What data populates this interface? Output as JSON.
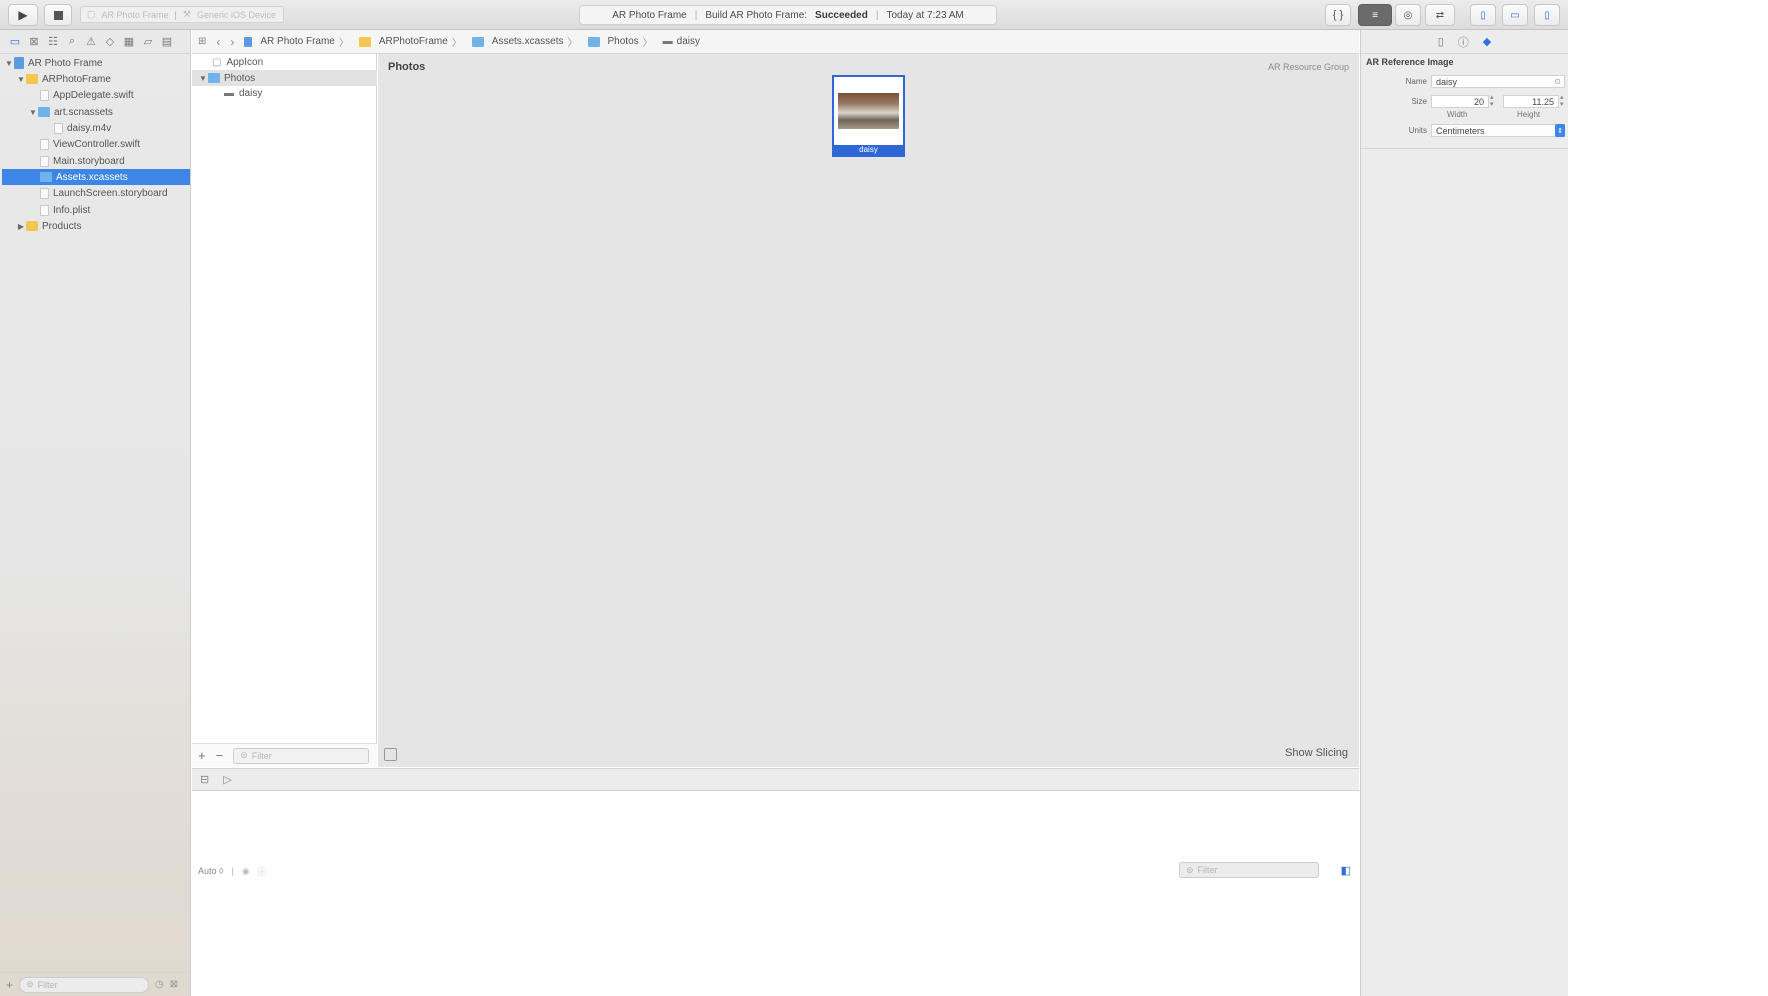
{
  "toolbar": {
    "scheme_target": "AR Photo Frame",
    "scheme_device": "Generic iOS Device",
    "activity_app": "AR Photo Frame",
    "activity_build": "Build AR Photo Frame:",
    "activity_status": "Succeeded",
    "activity_time": "Today at 7:23 AM",
    "run_icon": "play-icon",
    "stop_icon": "stop-icon"
  },
  "navigator": {
    "items": [
      {
        "label": "AR Photo Frame"
      },
      {
        "label": "ARPhotoFrame"
      },
      {
        "label": "AppDelegate.swift"
      },
      {
        "label": "art.scnassets"
      },
      {
        "label": "daisy.m4v"
      },
      {
        "label": "ViewController.swift"
      },
      {
        "label": "Main.storyboard"
      },
      {
        "label": "Assets.xcassets"
      },
      {
        "label": "LaunchScreen.storyboard"
      },
      {
        "label": "Info.plist"
      },
      {
        "label": "Products"
      }
    ],
    "filter_placeholder": "Filter"
  },
  "jumpbar": {
    "crumbs": [
      "AR Photo Frame",
      "ARPhotoFrame",
      "Assets.xcassets",
      "Photos",
      "daisy"
    ]
  },
  "assets": {
    "items": [
      {
        "label": "AppIcon"
      },
      {
        "label": "Photos"
      },
      {
        "label": "daisy"
      }
    ],
    "filter_placeholder": "Filter"
  },
  "canvas": {
    "title": "Photos",
    "group_label": "AR Resource Group",
    "image_caption": "daisy",
    "show_slicing": "Show Slicing"
  },
  "debug": {
    "auto_label": "Auto ◊",
    "filter_placeholder": "Filter"
  },
  "inspector": {
    "title": "AR Reference Image",
    "name_label": "Name",
    "name_value": "daisy",
    "size_label": "Size",
    "width_value": "20",
    "height_value": "11.25",
    "width_sub": "Width",
    "height_sub": "Height",
    "units_label": "Units",
    "units_value": "Centimeters"
  },
  "colors": {
    "accent": "#3d86e8",
    "selection": "#2f67d6",
    "canvas_bg": "#e5e5e5"
  }
}
